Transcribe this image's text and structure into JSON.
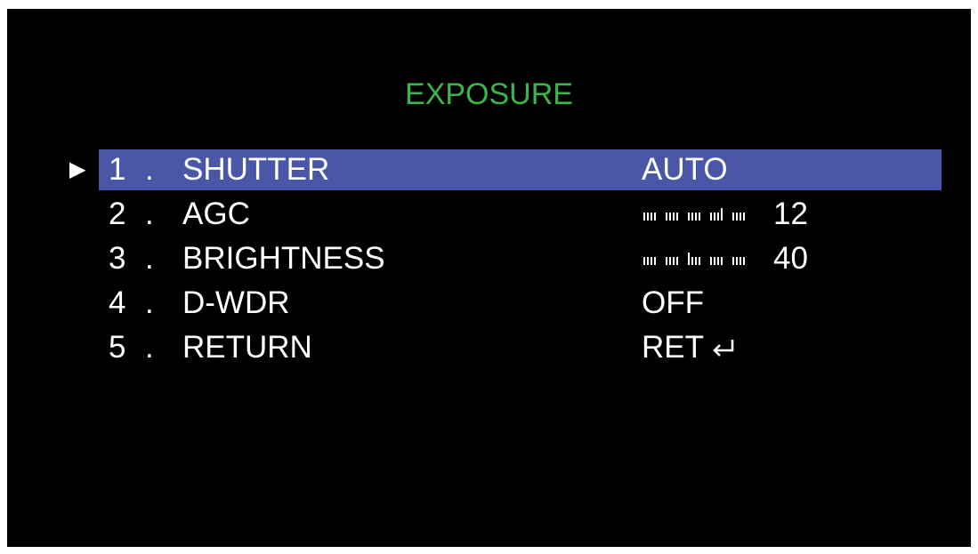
{
  "menu": {
    "title": "EXPOSURE",
    "pointer": "▶",
    "items": [
      {
        "num": "1",
        "dot": ".",
        "label": "SHUTTER",
        "value": "AUTO",
        "selected": true
      },
      {
        "num": "2",
        "dot": ".",
        "label": "AGC",
        "value": "12",
        "level": 0.8
      },
      {
        "num": "3",
        "dot": ".",
        "label": "BRIGHTNESS",
        "value": "40",
        "level": 0.4
      },
      {
        "num": "4",
        "dot": ".",
        "label": "D-WDR",
        "value": "OFF"
      },
      {
        "num": "5",
        "dot": ".",
        "label": "RETURN",
        "value": "RET"
      }
    ]
  },
  "colors": {
    "title": "#3cb54a",
    "highlight": "#4a56a6",
    "text": "#ffffff",
    "background": "#000000"
  },
  "icons": {
    "selection": "pointer-arrow-icon",
    "return": "return-arrow-icon"
  }
}
